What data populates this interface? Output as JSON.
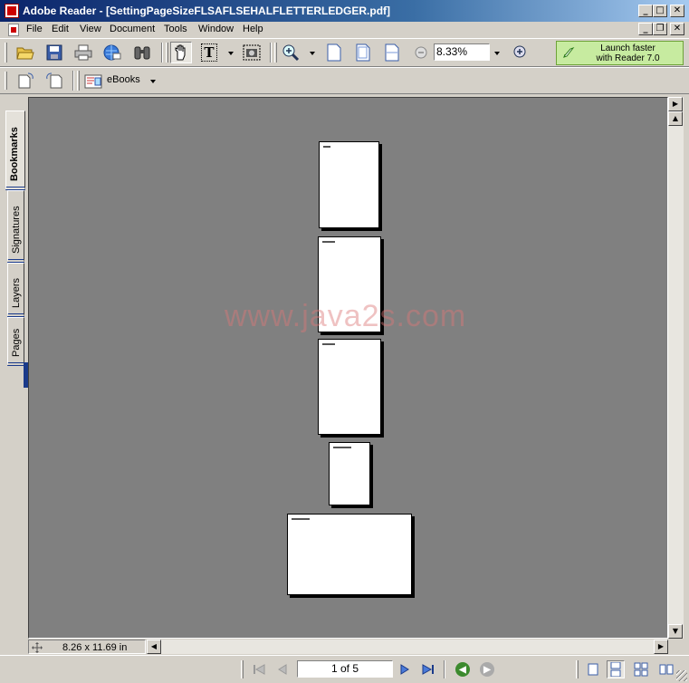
{
  "window": {
    "title": "Adobe Reader - [SettingPageSizeFLSAFLSEHALFLETTERLEDGER.pdf]",
    "controls": {
      "minimize": "_",
      "maximize": "□",
      "close": "✕"
    },
    "doc_controls": {
      "minimize": "_",
      "restore": "❐",
      "close": "✕"
    }
  },
  "menu": [
    "File",
    "Edit",
    "View",
    "Document",
    "Tools",
    "Window",
    "Help"
  ],
  "toolbar": {
    "zoom_value": "8.33%",
    "launch_line1": "Launch faster",
    "launch_line2": "with Reader 7.0",
    "ebooks_label": "eBooks",
    "text_select_glyph": "T"
  },
  "side_tabs": [
    "Bookmarks",
    "Signatures",
    "Layers",
    "Pages"
  ],
  "watermark": "www.java2s.com",
  "status": {
    "page_size": "8.26 x 11.69 in",
    "page_display": "1 of 5"
  },
  "colors": {
    "titlebar_start": "#0a246a",
    "chrome": "#d4d0c8",
    "view_background": "#808080",
    "launch_button": "#c7eba0",
    "nav_green": "#3c8a2e"
  },
  "icons": {
    "open": "folder-open-icon",
    "save": "floppy-icon",
    "print": "printer-icon",
    "email": "globe-mail-icon",
    "search": "binoculars-icon",
    "hand": "hand-icon",
    "text_select": "text-select-icon",
    "snapshot": "camera-icon",
    "zoom_in": "magnifier-plus-icon",
    "actual_size": "page-icon",
    "fit_page": "page-fit-icon",
    "fit_width": "page-width-icon"
  }
}
